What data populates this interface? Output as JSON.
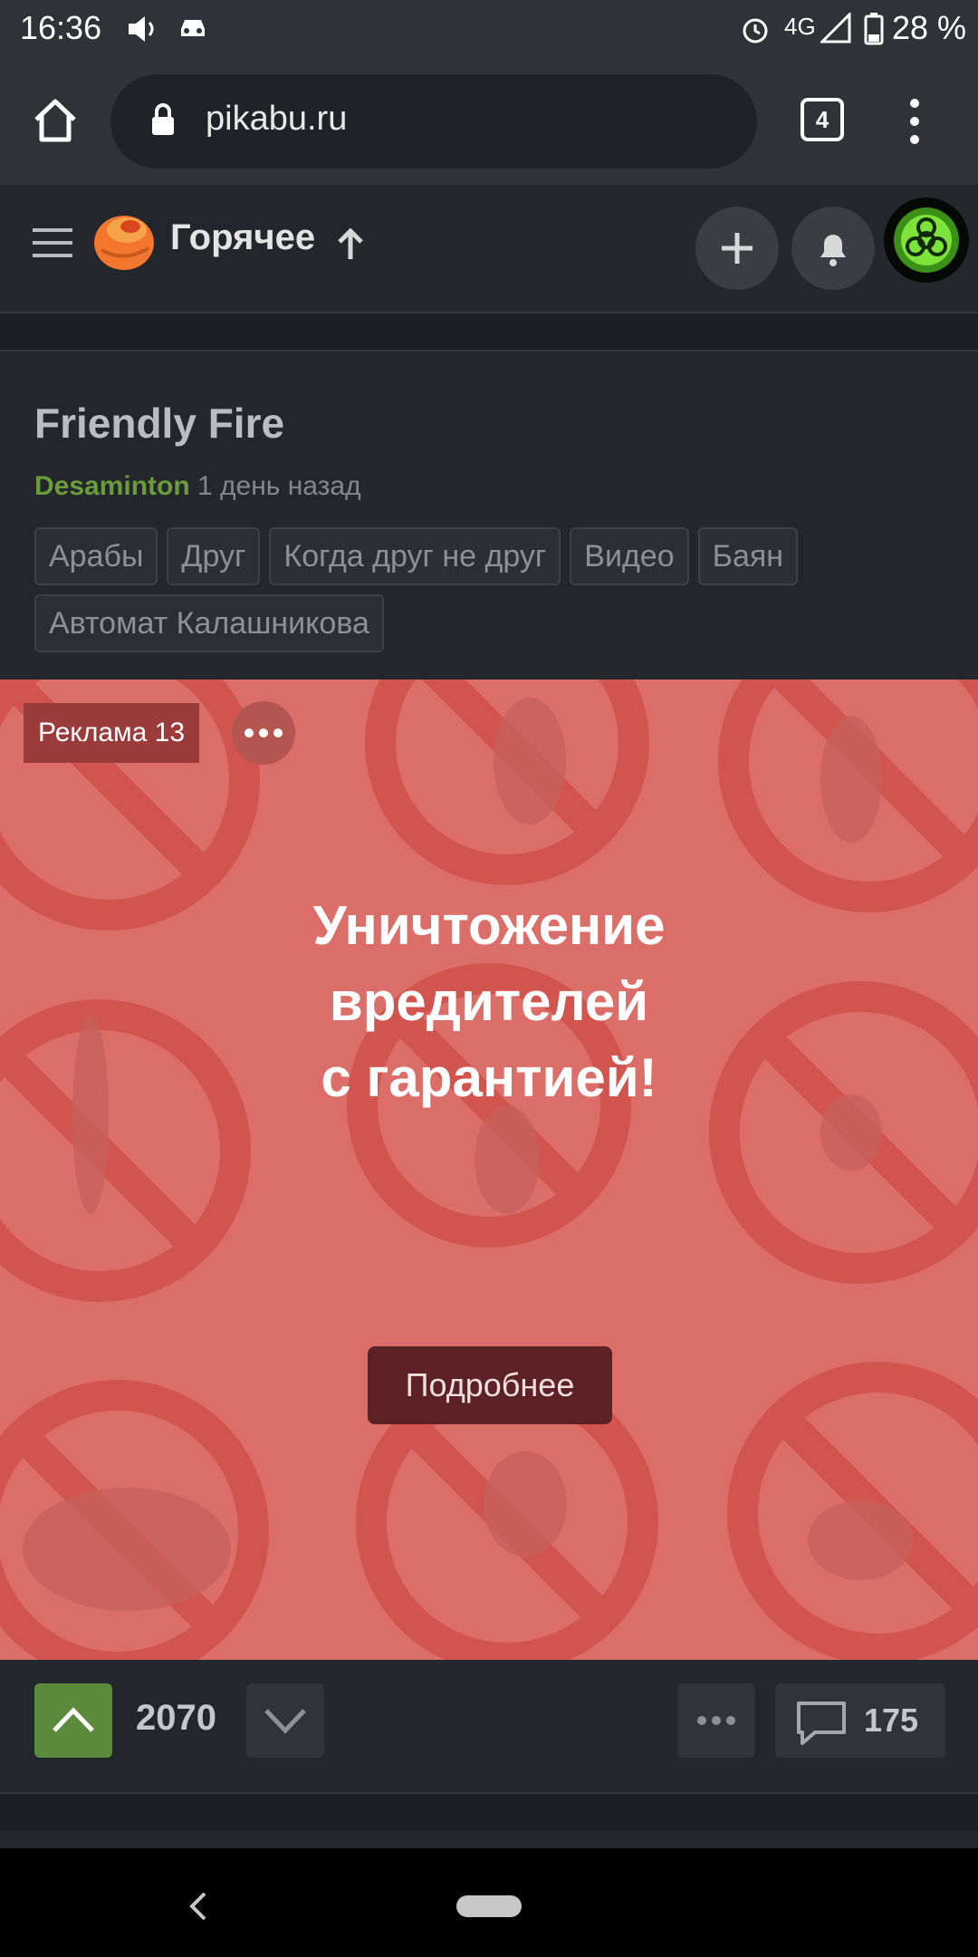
{
  "status_bar": {
    "time": "16:36",
    "network": "4G",
    "battery": "28 %"
  },
  "browser": {
    "url": "pikabu.ru",
    "tab_count": "4"
  },
  "app_header": {
    "section_title": "Горячее"
  },
  "post": {
    "title": "Friendly Fire",
    "author": "Desaminton",
    "time": "1 день назад",
    "tags": [
      "Арабы",
      "Друг",
      "Когда друг не друг",
      "Видео",
      "Баян",
      "Автомат Калашникова"
    ]
  },
  "ad": {
    "label": "Реклама 13",
    "headline_lines": [
      "Уничтожение",
      "вредителей",
      "с гарантией!"
    ],
    "button": "Подробнее",
    "background_color": "#db6e69"
  },
  "post_footer": {
    "rating": "2070",
    "comments": "175"
  }
}
